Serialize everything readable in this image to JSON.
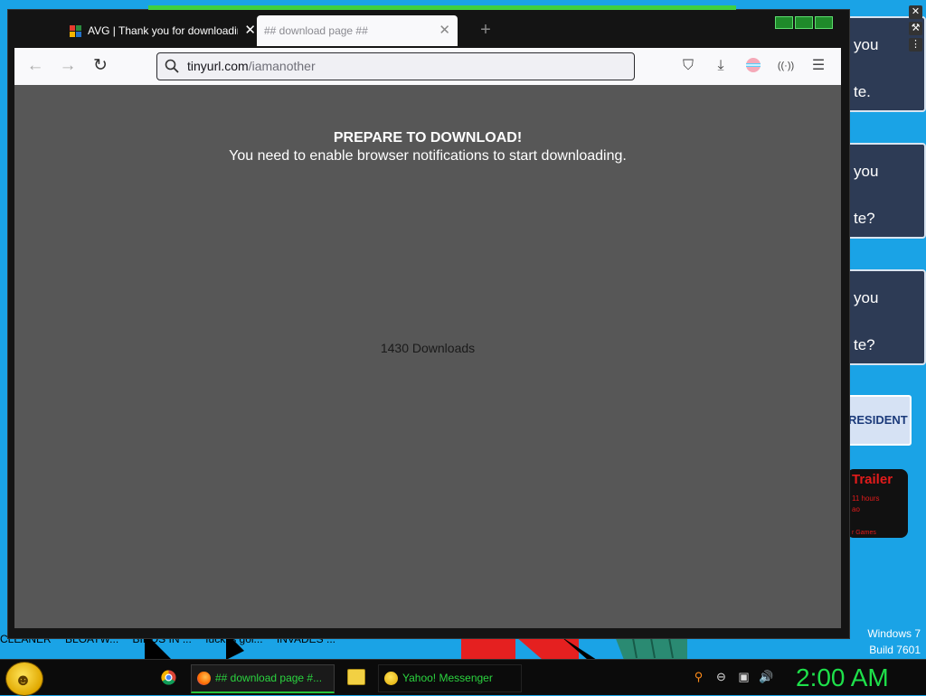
{
  "browser": {
    "tabs": [
      {
        "title": "AVG | Thank you for downloading",
        "active": false,
        "favicon": "avg-icon"
      },
      {
        "title": "## download page ##",
        "active": true,
        "favicon": null
      }
    ],
    "new_tab_glyph": "+",
    "url": {
      "host": "tinyurl.com",
      "path": "/iamanother"
    }
  },
  "page": {
    "heading": "PREPARE TO DOWNLOAD!",
    "subheading": "You need to enable browser notifications to start downloading.",
    "downloads": "1430 Downloads"
  },
  "desktop": {
    "gadgets": [
      {
        "line1": "you",
        "line2": "te."
      },
      {
        "line1": "you",
        "line2": "te?"
      },
      {
        "line1": "you",
        "line2": "te?"
      }
    ],
    "president_label": "RESIDENT",
    "trailer": {
      "title": "Trailer",
      "line1": "11 hours",
      "line2": "ao",
      "line3": "r Games"
    },
    "news": [
      "CLEANER",
      "BLOATW...",
      "BIRDS IN ...",
      "fuck is goi...",
      "INVADES ..."
    ],
    "windows_label": "Windows 7",
    "build_label": "Build 7601"
  },
  "taskbar": {
    "tasks": [
      {
        "label": "## download page #...",
        "icon": "firefox-icon",
        "active": true
      },
      {
        "label": "Yahoo! Messenger",
        "icon": "yahoo-messenger-icon",
        "active": false
      }
    ],
    "clock": "2:00 AM"
  },
  "colors": {
    "accent_green": "#2bd43f",
    "content_bg": "#575757",
    "desktop_bg": "#1aa3e6"
  }
}
